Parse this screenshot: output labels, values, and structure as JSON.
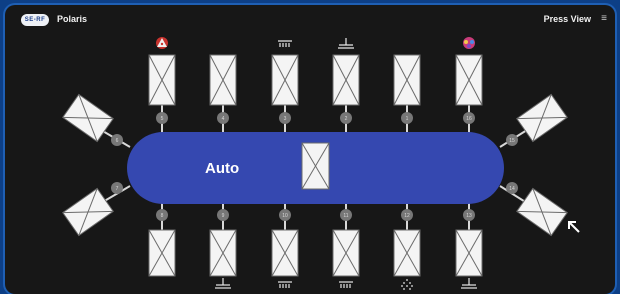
{
  "app": {
    "logo_text": "SE-RF",
    "title": "Polaris"
  },
  "header": {
    "view_button": "Press View",
    "menu_icon": "hamburger-menu-icon"
  },
  "table": {
    "mode_label": "Auto",
    "color": "#3548b0"
  },
  "top_ports": [
    "5",
    "4",
    "3",
    "2",
    "1",
    "16"
  ],
  "bottom_ports": [
    "8",
    "9",
    "10",
    "11",
    "12",
    "13"
  ],
  "left_ports": [
    "6",
    "7"
  ],
  "right_ports": [
    "15",
    "14"
  ],
  "station_icons": {
    "top": [
      "warning-triangle-icon",
      "",
      "shower-head-icon",
      "sink-faucet-icon",
      "",
      "user-group-icon"
    ],
    "bottom": [
      "",
      "sink-faucet-icon",
      "shower-head-icon",
      "shower-head-icon",
      "spray-icon",
      "sink-faucet-icon"
    ]
  },
  "colors": {
    "background": "#171717",
    "frame_border": "#1e5fb4",
    "table": "#3548b0"
  }
}
